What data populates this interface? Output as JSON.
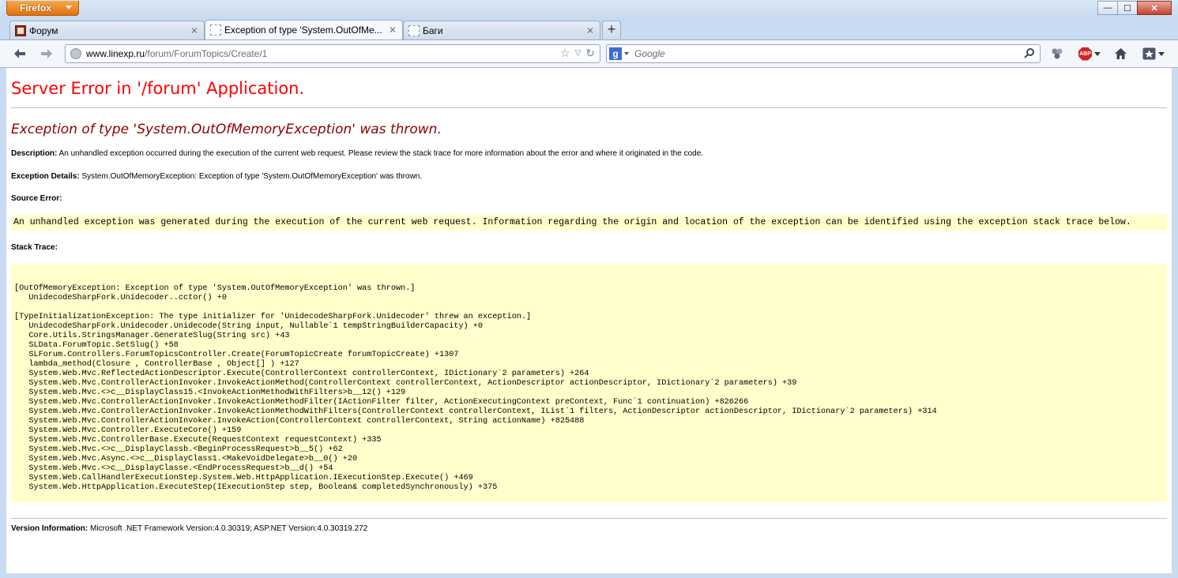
{
  "window": {
    "app_button": "Firefox",
    "controls": {
      "minimize": "—",
      "maximize": "☐",
      "close": "✕"
    }
  },
  "tabs": [
    {
      "label": "Форум",
      "favicon": "forum-favicon",
      "active": false
    },
    {
      "label": "Exception of type 'System.OutOfMe...",
      "favicon": "blank-page-icon",
      "active": true
    },
    {
      "label": "Баги",
      "favicon": "blank-page-icon",
      "active": false
    }
  ],
  "newtab_label": "+",
  "toolbar": {
    "url_domain": "www.linexp.ru",
    "url_path": "/forum/ForumTopics/Create/1",
    "search_placeholder": "Google",
    "search_engine_letter": "g",
    "adblock_label": "ABP"
  },
  "page": {
    "title": "Server Error in '/forum' Application.",
    "exception_heading": "Exception of type 'System.OutOfMemoryException' was thrown.",
    "description_label": "Description:",
    "description_text": " An unhandled exception occurred during the execution of the current web request. Please review the stack trace for more information about the error and where it originated in the code.",
    "details_label": "Exception Details:",
    "details_text": " System.OutOfMemoryException: Exception of type 'System.OutOfMemoryException' was thrown.",
    "source_error_label": "Source Error:",
    "source_error_text": "An unhandled exception was generated during the execution of the current web request. Information regarding the origin and location of the exception can be identified using the exception stack trace below.",
    "stack_trace_label": "Stack Trace:",
    "stack_trace": "[OutOfMemoryException: Exception of type 'System.OutOfMemoryException' was thrown.]\n   UnidecodeSharpFork.Unidecoder..cctor() +0\n\n[TypeInitializationException: The type initializer for 'UnidecodeSharpFork.Unidecoder' threw an exception.]\n   UnidecodeSharpFork.Unidecoder.Unidecode(String input, Nullable`1 tempStringBuilderCapacity) +0\n   Core.Utils.StringsManager.GenerateSlug(String src) +43\n   SLData.ForumTopic.SetSlug() +58\n   SLForum.Controllers.ForumTopicsController.Create(ForumTopicCreate forumTopicCreate) +1307\n   lambda_method(Closure , ControllerBase , Object[] ) +127\n   System.Web.Mvc.ReflectedActionDescriptor.Execute(ControllerContext controllerContext, IDictionary`2 parameters) +264\n   System.Web.Mvc.ControllerActionInvoker.InvokeActionMethod(ControllerContext controllerContext, ActionDescriptor actionDescriptor, IDictionary`2 parameters) +39\n   System.Web.Mvc.<>c__DisplayClass15.<InvokeActionMethodWithFilters>b__12() +129\n   System.Web.Mvc.ControllerActionInvoker.InvokeActionMethodFilter(IActionFilter filter, ActionExecutingContext preContext, Func`1 continuation) +826266\n   System.Web.Mvc.ControllerActionInvoker.InvokeActionMethodWithFilters(ControllerContext controllerContext, IList`1 filters, ActionDescriptor actionDescriptor, IDictionary`2 parameters) +314\n   System.Web.Mvc.ControllerActionInvoker.InvokeAction(ControllerContext controllerContext, String actionName) +825488\n   System.Web.Mvc.Controller.ExecuteCore() +159\n   System.Web.Mvc.ControllerBase.Execute(RequestContext requestContext) +335\n   System.Web.Mvc.<>c__DisplayClassb.<BeginProcessRequest>b__5() +62\n   System.Web.Mvc.Async.<>c__DisplayClass1.<MakeVoidDelegate>b__0() +20\n   System.Web.Mvc.<>c__DisplayClasse.<EndProcessRequest>b__d() +54\n   System.Web.CallHandlerExecutionStep.System.Web.HttpApplication.IExecutionStep.Execute() +469\n   System.Web.HttpApplication.ExecuteStep(IExecutionStep step, Boolean& completedSynchronously) +375",
    "version_label": "Version Information:",
    "version_text": " Microsoft .NET Framework Version:4.0.30319; ASP.NET Version:4.0.30319.272"
  },
  "colors": {
    "error_title": "#ff0000",
    "exception_heading": "#8b0000",
    "code_background": "#ffffcc",
    "firefox_orange": "#e2710c"
  }
}
